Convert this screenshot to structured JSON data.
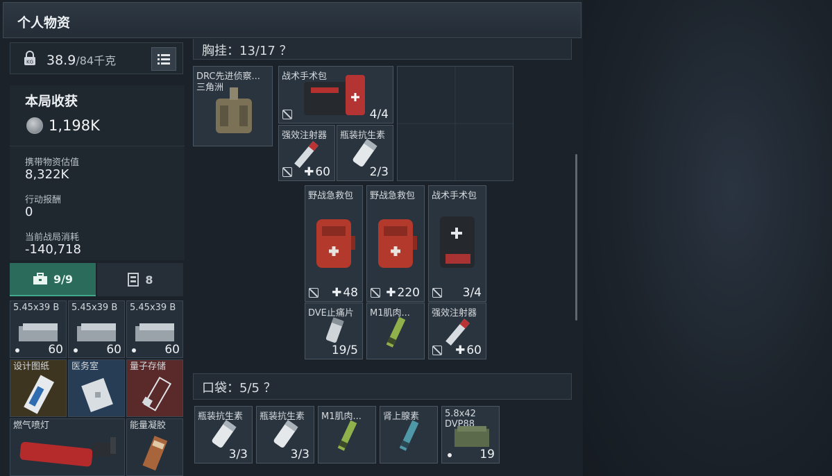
{
  "header": {
    "title": "个人物资"
  },
  "weight": {
    "current": "38.9",
    "max": "/84千克"
  },
  "stats": {
    "title": "本局收获",
    "coin_value": "1,198K",
    "carry_label": "携带物资估值",
    "carry_value": "8,322K",
    "reward_label": "行动报酬",
    "reward_value": "0",
    "cost_label": "当前战局消耗",
    "cost_value": "-140,718"
  },
  "tabs": [
    {
      "label": "9/9",
      "icon": "toolbox-icon"
    },
    {
      "label": "8",
      "icon": "safe-icon"
    }
  ],
  "left_items": [
    {
      "label": "5.45x39 B",
      "count": "60"
    },
    {
      "label": "5.45x39 B",
      "count": "60"
    },
    {
      "label": "5.45x39 B",
      "count": "60"
    },
    {
      "label": "设计图纸",
      "count": ""
    },
    {
      "label": "医务室",
      "count": ""
    },
    {
      "label": "量子存储",
      "count": ""
    },
    {
      "label": "燃气喷灯",
      "count": ""
    },
    {
      "label": "能量凝胶",
      "count": ""
    }
  ],
  "chest": {
    "title": "胸挂：13/17 ？",
    "rig_label": "DRC先进侦察...",
    "rig_sublabel": "三角洲",
    "items": [
      {
        "label": "战术手术包",
        "count": "4/4"
      },
      {
        "label": "强效注射器",
        "count": "60"
      },
      {
        "label": "瓶装抗生素",
        "count": "2/3"
      },
      {
        "label": "野战急救包",
        "count": "48"
      },
      {
        "label": "野战急救包",
        "count": "220"
      },
      {
        "label": "战术手术包",
        "count": "3/4"
      },
      {
        "label": "DVE止痛片",
        "count": "19/5"
      },
      {
        "label": "M1肌肉...",
        "count": ""
      },
      {
        "label": "强效注射器",
        "count": "60"
      }
    ]
  },
  "pocket": {
    "title": "口袋：5/5 ？",
    "items": [
      {
        "label": "瓶装抗生素",
        "count": "3/3"
      },
      {
        "label": "瓶装抗生素",
        "count": "3/3"
      },
      {
        "label": "M1肌肉...",
        "count": ""
      },
      {
        "label": "肾上腺素",
        "count": ""
      },
      {
        "label": "5.8x42 DVP88",
        "count": "19"
      }
    ]
  },
  "colors": {
    "accent": "#2b6b5c",
    "panel": "#1b2229",
    "red_item": "#5a2a2b"
  }
}
